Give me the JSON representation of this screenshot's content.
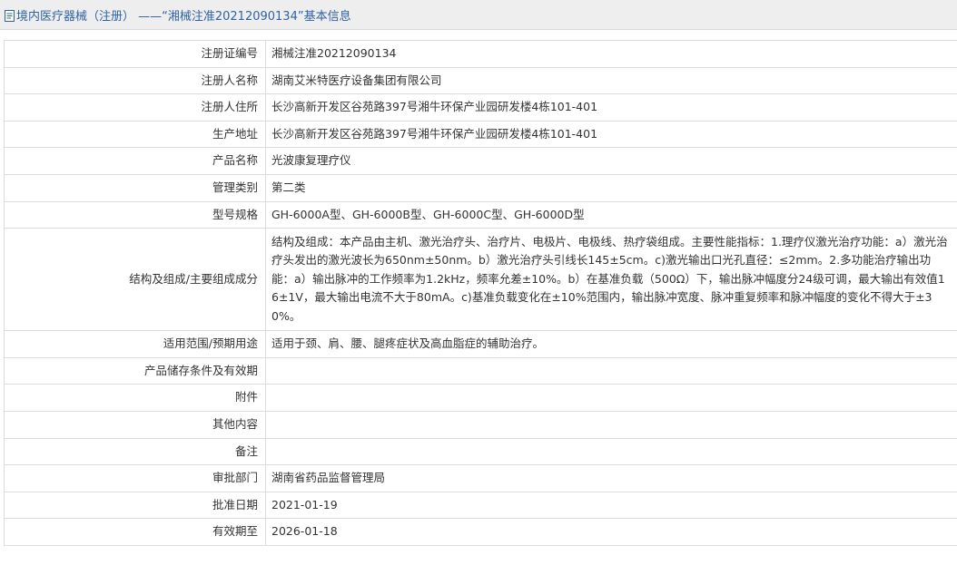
{
  "page": {
    "title": "境内医疗器械（注册） ——“湘械注准20212090134”基本信息",
    "title_icon": "document-icon"
  },
  "record": [
    {
      "key": "registration-number",
      "label": "注册证编号",
      "value": "湘械注准20212090134"
    },
    {
      "key": "registrant-name",
      "label": "注册人名称",
      "value": "湖南艾米特医疗设备集团有限公司"
    },
    {
      "key": "registrant-address",
      "label": "注册人住所",
      "value": "长沙高新开发区谷苑路397号湘牛环保产业园研发楼4栋101-401"
    },
    {
      "key": "production-address",
      "label": "生产地址",
      "value": "长沙高新开发区谷苑路397号湘牛环保产业园研发楼4栋101-401"
    },
    {
      "key": "product-name",
      "label": "产品名称",
      "value": "光波康复理疗仪"
    },
    {
      "key": "management-class",
      "label": "管理类别",
      "value": "第二类"
    },
    {
      "key": "model-spec",
      "label": "型号规格",
      "value": "GH-6000A型、GH-6000B型、GH-6000C型、GH-6000D型"
    },
    {
      "key": "structure",
      "label": "结构及组成/主要组成成分",
      "value": "结构及组成：本产品由主机、激光治疗头、治疗片、电极片、电极线、热疗袋组成。主要性能指标：1.理疗仪激光治疗功能：a）激光治疗头发出的激光波长为650nm±50nm。b）激光治疗头引线长145±5cm。c)激光输出口光孔直径：≤2mm。2.多功能治疗输出功能：a）输出脉冲的工作频率为1.2kHz，频率允差±10%。b）在基准负载（500Ω）下，输出脉冲幅度分24级可调，最大输出有效值16±1V，最大输出电流不大于80mA。c)基准负载变化在±10%范围内，输出脉冲宽度、脉冲重复频率和脉冲幅度的变化不得大于±30%。"
    },
    {
      "key": "scope",
      "label": "适用范围/预期用途",
      "value": "适用于颈、肩、腰、腿疼症状及高血脂症的辅助治疗。"
    },
    {
      "key": "storage",
      "label": "产品储存条件及有效期",
      "value": ""
    },
    {
      "key": "attachment",
      "label": "附件",
      "value": ""
    },
    {
      "key": "other",
      "label": "其他内容",
      "value": ""
    },
    {
      "key": "remarks",
      "label": "备注",
      "value": ""
    },
    {
      "key": "approval-dept",
      "label": "审批部门",
      "value": "湖南省药品监督管理局"
    },
    {
      "key": "approval-date",
      "label": "批准日期",
      "value": "2021-01-19"
    },
    {
      "key": "valid-until",
      "label": "有效期至",
      "value": "2026-01-18"
    }
  ]
}
